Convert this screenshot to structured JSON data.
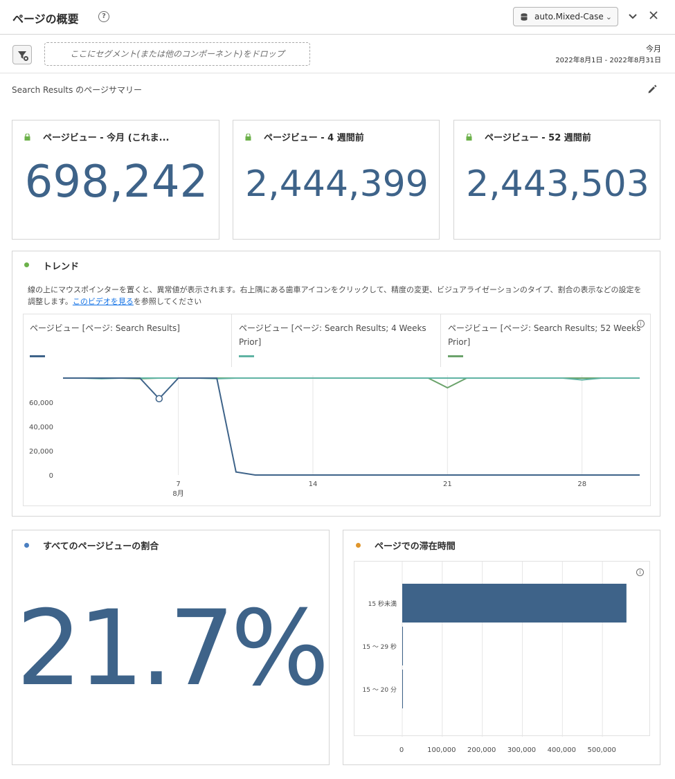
{
  "header": {
    "title": "ページの概要",
    "segment_dropdown": "auto.Mixed-Case"
  },
  "filter_bar": {
    "drop_zone_placeholder": "ここにセグメント(または他のコンポーネント)をドロップ",
    "date_label": "今月",
    "date_range": "2022年8月1日 - 2022年8月31日"
  },
  "subtitle": "Search Results のページサマリー",
  "kpis": [
    {
      "title": "ページビュー - 今月 (これま...",
      "value": "698,242"
    },
    {
      "title": "ページビュー - 4 週間前",
      "value": "2,444,399"
    },
    {
      "title": "ページビュー - 52 週間前",
      "value": "2,443,503"
    }
  ],
  "trend": {
    "title": "トレンド",
    "description_before_link": "線の上にマウスポインターを置くと、異常値が表示されます。右上隅にある歯車アイコンをクリックして、精度の変更、ビジュアライゼーションのタイプ、割合の表示などの設定を調整します。",
    "link_text": "このビデオを見る",
    "description_after_link": "を参照してください",
    "legend": [
      {
        "label": "ページビュー [ページ: Search Results]",
        "color": "#3e6389"
      },
      {
        "label": "ページビュー [ページ: Search Results; 4 Weeks Prior]",
        "color": "#5fb3a3"
      },
      {
        "label": "ページビュー [ページ: Search Results; 52 Weeks Prior]",
        "color": "#6ba36b"
      }
    ]
  },
  "share": {
    "title": "すべてのページビューの割合",
    "value": "21.7%"
  },
  "time_on_page": {
    "title": "ページでの滞在時間"
  },
  "colors": {
    "accent_blue": "#3e6389",
    "green_dot": "#6cb14a",
    "blue_dot": "#4a7fc1",
    "orange_dot": "#e0962c"
  },
  "chart_data": [
    {
      "type": "line",
      "x_ticks": [
        "7",
        "14",
        "21",
        "28"
      ],
      "x_month_label": "8月",
      "y_ticks": [
        "0",
        "20,000",
        "40,000",
        "60,000"
      ],
      "ylim": [
        0,
        80000
      ],
      "x": [
        1,
        2,
        3,
        4,
        5,
        6,
        7,
        8,
        9,
        10,
        11,
        12,
        13,
        14,
        15,
        16,
        17,
        18,
        19,
        20,
        21,
        22,
        23,
        24,
        25,
        26,
        27,
        28,
        29,
        30,
        31
      ],
      "series": [
        {
          "name": "ページビュー [ページ: Search Results]",
          "color": "#3e6389",
          "values": [
            80000,
            80000,
            80000,
            80000,
            80000,
            63000,
            80000,
            80000,
            80000,
            2500,
            0,
            0,
            0,
            0,
            0,
            0,
            0,
            0,
            0,
            0,
            0,
            0,
            0,
            0,
            0,
            0,
            0,
            0,
            0,
            0,
            0
          ]
        },
        {
          "name": "ページビュー [ページ: Search Results; 4 Weeks Prior]",
          "color": "#5fb3a3",
          "values": [
            80000,
            80000,
            79500,
            80000,
            80000,
            80000,
            80000,
            80000,
            79500,
            80000,
            80000,
            80000,
            80000,
            80000,
            80000,
            80000,
            80000,
            80000,
            80000,
            80000,
            80000,
            80000,
            80000,
            80000,
            80000,
            80000,
            80000,
            78500,
            80000,
            80000,
            80000
          ]
        },
        {
          "name": "ページビュー [ページ: Search Results; 52 Weeks Prior]",
          "color": "#6ba36b",
          "values": [
            80000,
            80000,
            80000,
            80000,
            79500,
            80000,
            80000,
            80000,
            80000,
            80000,
            80000,
            80000,
            80000,
            80000,
            80000,
            80000,
            80000,
            80000,
            80000,
            80000,
            72000,
            80000,
            80000,
            80000,
            80000,
            80000,
            80000,
            80000,
            80000,
            80000,
            80000
          ]
        }
      ],
      "grid": true
    },
    {
      "type": "bar",
      "orientation": "horizontal",
      "categories": [
        "15 秒未満",
        "15 ～ 29 秒",
        "15 ～ 20 分"
      ],
      "values": [
        560000,
        0,
        0
      ],
      "x_ticks": [
        "0",
        "100,000",
        "200,000",
        "300,000",
        "400,000",
        "500,000"
      ],
      "xlim": [
        0,
        600000
      ],
      "color": "#3e6389",
      "grid": true
    }
  ]
}
